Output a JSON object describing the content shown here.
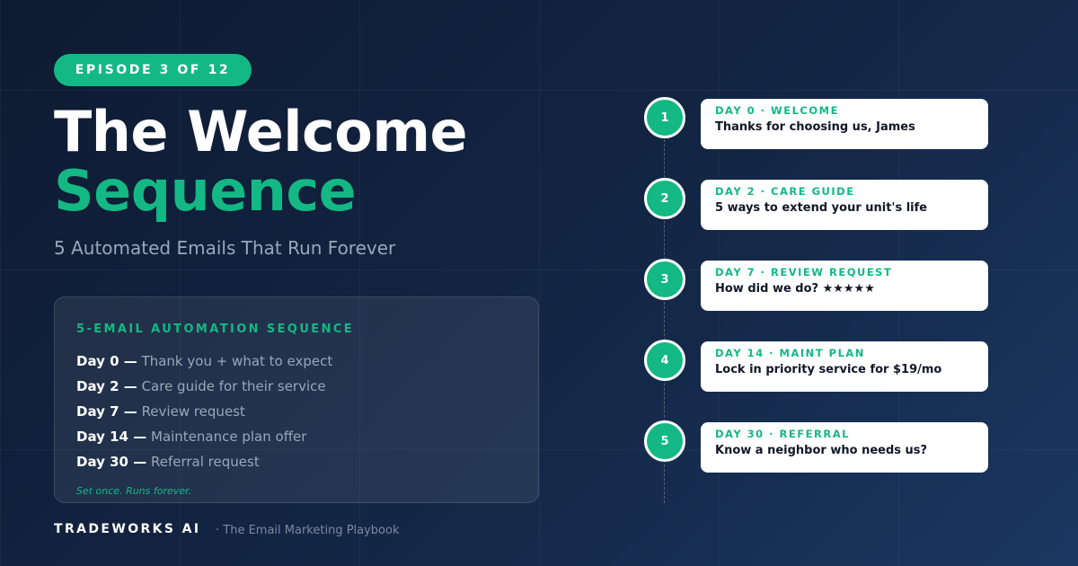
{
  "badge": "EPISODE 3 OF 12",
  "title": {
    "line1": "The Welcome",
    "line2": "Sequence"
  },
  "subtitle": "5 Automated Emails That Run Forever",
  "panel": {
    "heading": "5-EMAIL AUTOMATION SEQUENCE",
    "rows": [
      {
        "day": "Day 0 —",
        "desc": "Thank you + what to expect"
      },
      {
        "day": "Day 2 —",
        "desc": "Care guide for their service"
      },
      {
        "day": "Day 7 —",
        "desc": "Review request"
      },
      {
        "day": "Day 14 —",
        "desc": "Maintenance plan offer"
      },
      {
        "day": "Day 30 —",
        "desc": "Referral request"
      }
    ],
    "note": "Set once. Runs forever."
  },
  "footer": {
    "brand": "TRADEWORKS AI",
    "tagline": "· The Email Marketing Playbook"
  },
  "timeline": [
    {
      "number": "1",
      "label": "DAY 0 · WELCOME",
      "title": "Thanks for choosing us, James"
    },
    {
      "number": "2",
      "label": "DAY 2 · CARE GUIDE",
      "title": "5 ways to extend your unit's life"
    },
    {
      "number": "3",
      "label": "DAY 7 · REVIEW REQUEST",
      "title": "How did we do? ★★★★★"
    },
    {
      "number": "4",
      "label": "DAY 14 · MAINT PLAN",
      "title": "Lock in priority service for $19/mo"
    },
    {
      "number": "5",
      "label": "DAY 30 · REFERRAL",
      "title": "Know a neighbor who needs us?"
    }
  ],
  "colors": {
    "accent": "#13b884",
    "background_start": "#0e1a31",
    "background_end": "#1b3761",
    "muted_text": "#9aa7b9",
    "card_text": "#111827"
  }
}
